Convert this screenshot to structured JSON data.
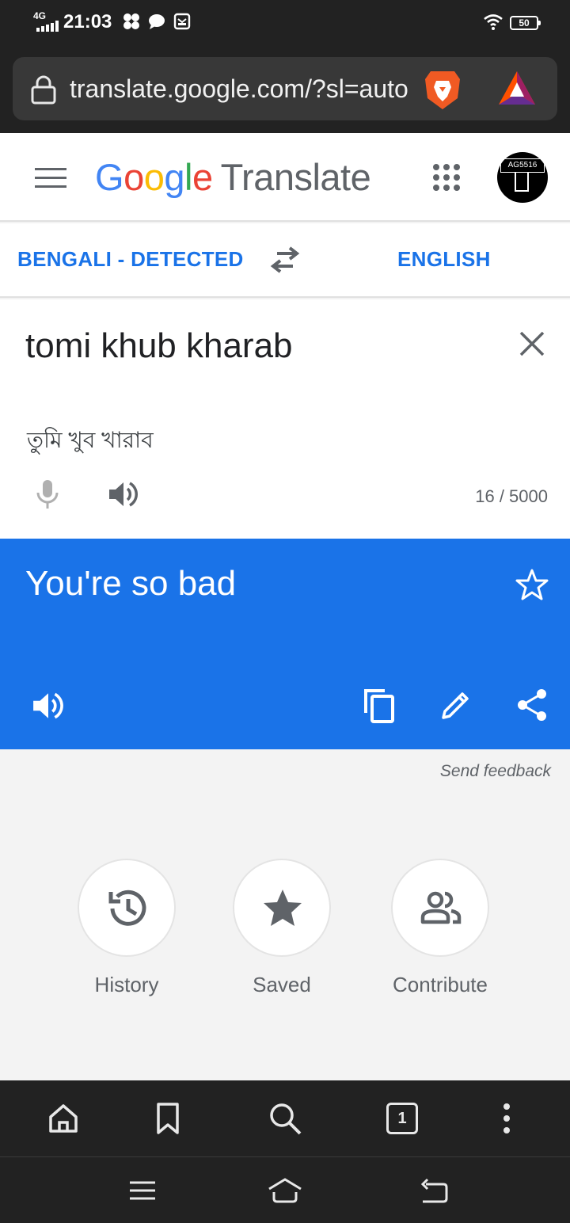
{
  "status_bar": {
    "network": "4G",
    "time": "21:03",
    "battery": "50",
    "icons": [
      "pinwheel-icon",
      "chat-icon",
      "inbox-icon",
      "wifi-icon",
      "signal-icon"
    ]
  },
  "browser": {
    "url": "translate.google.com/?sl=auto",
    "icons": [
      "lock-icon",
      "brave-lion-icon",
      "bat-triangle-icon"
    ]
  },
  "header": {
    "logo_letters": [
      "G",
      "o",
      "o",
      "g",
      "l",
      "e"
    ],
    "product": "Translate",
    "avatar_text": "AG5516",
    "colors": {
      "blue": "#4285f4",
      "red": "#ea4335",
      "yellow": "#fbbc05",
      "green": "#34a853"
    }
  },
  "languages": {
    "source": "BENGALI - DETECTED",
    "target": "ENGLISH",
    "accent": "#1a73e8"
  },
  "input": {
    "text": "tomi khub kharab",
    "transliteration": "তুমি খুব খারাব",
    "char_count": "16 / 5000"
  },
  "result": {
    "text": "You're so bad",
    "background": "#1a73e8"
  },
  "feedback": "Send feedback",
  "shortcuts": [
    {
      "label": "History",
      "icon": "history-icon"
    },
    {
      "label": "Saved",
      "icon": "star-icon"
    },
    {
      "label": "Contribute",
      "icon": "people-icon"
    }
  ],
  "toolbar": {
    "tab_count": "1",
    "icons": [
      "home-icon",
      "bookmark-icon",
      "search-icon",
      "tabs-icon",
      "more-vert-icon"
    ]
  },
  "nav": {
    "icons": [
      "recents-icon",
      "home-nav-icon",
      "back-icon"
    ]
  }
}
